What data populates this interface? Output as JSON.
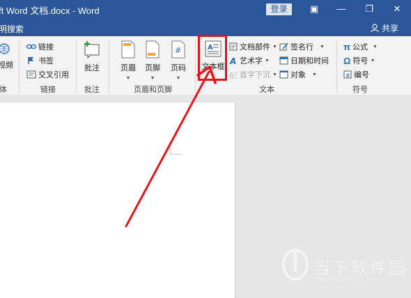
{
  "titlebar": {
    "title": "ft Word 文档.docx  -  Word",
    "login": "登录",
    "buttons": {
      "ribbon_display": "▣",
      "minimize": "—",
      "restore": "❐",
      "close": "✕"
    }
  },
  "menubar": {
    "tell_me": "明搜索",
    "share": "共享"
  },
  "ribbon": {
    "media": {
      "video": "视频",
      "group": "体"
    },
    "links": {
      "link": "链接",
      "bookmark": "书签",
      "cross_ref": "交叉引用",
      "group": "链接"
    },
    "comments": {
      "comment": "批注",
      "group": "批注"
    },
    "header_footer": {
      "header": "页眉",
      "footer": "页脚",
      "page_number": "页码",
      "group": "页眉和页脚"
    },
    "text": {
      "textbox": "文本框",
      "quick_parts": "文档部件",
      "wordart": "艺术字",
      "dropcap": "首字下沉",
      "signature": "签名行",
      "datetime": "日期和时间",
      "object": "对象",
      "group": "文本"
    },
    "symbols": {
      "equation": "公式",
      "symbol": "符号",
      "number": "编号",
      "group": "符号"
    }
  },
  "watermark": {
    "brand": "当下软件园",
    "url": "www.downxia.com"
  },
  "colors": {
    "title_blue": "#2b579a",
    "highlight_red": "#e0141c",
    "arrow_red": "#e8141b"
  }
}
